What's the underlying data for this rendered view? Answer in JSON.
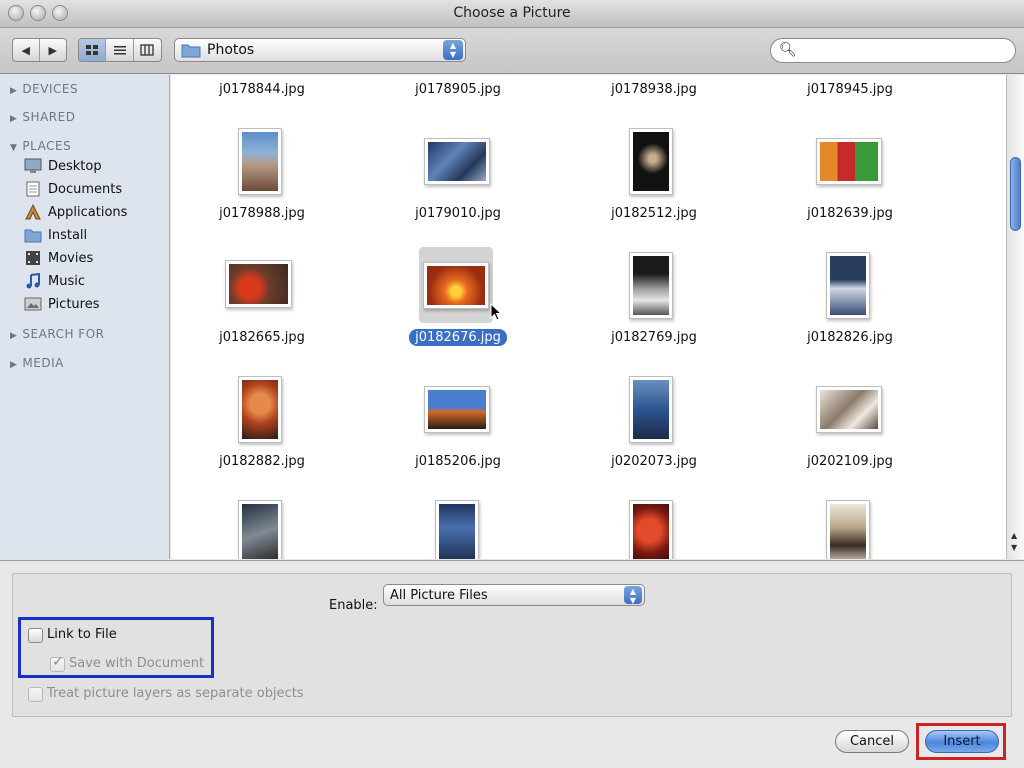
{
  "window": {
    "title": "Choose a Picture"
  },
  "toolbar": {
    "nav": [
      "◀",
      "▶"
    ],
    "views": [
      "icon-view",
      "list-view",
      "column-view"
    ],
    "location": "Photos",
    "search": {
      "value": "",
      "placeholder": ""
    }
  },
  "sidebar": {
    "sections": {
      "devices": "DEVICES",
      "shared": "SHARED",
      "places": "PLACES",
      "search_for": "SEARCH FOR",
      "media": "MEDIA"
    },
    "items": [
      {
        "label": "Desktop",
        "icon": "desktop-icon"
      },
      {
        "label": "Documents",
        "icon": "documents-icon"
      },
      {
        "label": "Applications",
        "icon": "applications-icon"
      },
      {
        "label": "Install",
        "icon": "folder-icon"
      },
      {
        "label": "Movies",
        "icon": "movies-icon"
      },
      {
        "label": "Music",
        "icon": "music-icon"
      },
      {
        "label": "Pictures",
        "icon": "pictures-icon"
      }
    ]
  },
  "files": {
    "row0": [
      "j0178844.jpg",
      "j0178905.jpg",
      "j0178938.jpg",
      "j0178945.jpg"
    ],
    "row1": [
      "j0178988.jpg",
      "j0179010.jpg",
      "j0182512.jpg",
      "j0182639.jpg"
    ],
    "row2": [
      "j0182665.jpg",
      "j0182676.jpg",
      "j0182769.jpg",
      "j0182826.jpg"
    ],
    "row3": [
      "j0182882.jpg",
      "j0185206.jpg",
      "j0202073.jpg",
      "j0202109.jpg"
    ],
    "selected": "j0182676.jpg"
  },
  "options": {
    "enable_label": "Enable:",
    "enable_value": "All Picture Files",
    "link_to_file": "Link to File",
    "save_with_document": "Save with Document",
    "treat_layers": "Treat picture layers as separate objects"
  },
  "buttons": {
    "cancel": "Cancel",
    "insert": "Insert"
  },
  "colors": {
    "accent": "#3b6fc7",
    "highlight_blue": "#1a2fc8",
    "highlight_red": "#cc2424"
  }
}
